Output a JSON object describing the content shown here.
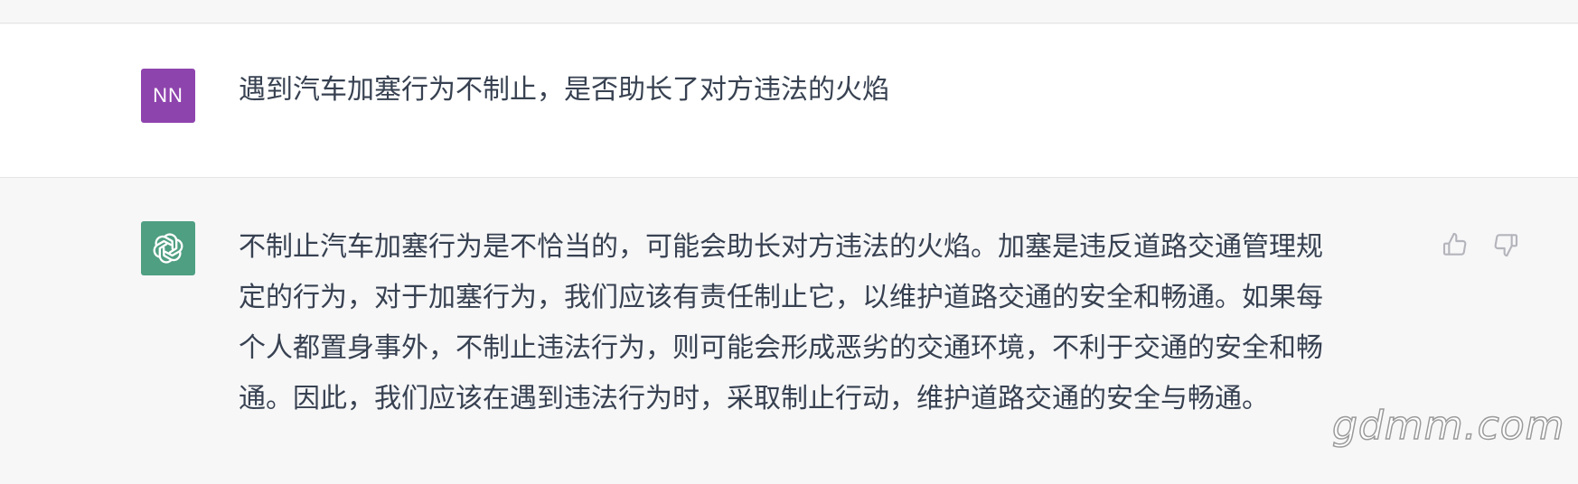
{
  "user_message": {
    "avatar_initials": "NN",
    "text": "遇到汽车加塞行为不制止，是否助长了对方违法的火焰"
  },
  "assistant_message": {
    "avatar_icon": "openai-logo-icon",
    "lines": [
      "不制止汽车加塞行为是不恰当的，可能会助长对方违法的火焰。加塞是违反道路交通管理规",
      "定的行为，对于加塞行为，我们应该有责任制止它，以维护道路交通的安全和畅通。如果每",
      "个人都置身事外，不制止违法行为，则可能会形成恶劣的交通环境，不利于交通的安全和畅",
      "通。因此，我们应该在遇到违法行为时，采取制止行动，维护道路交通的安全与畅通。"
    ]
  },
  "feedback": {
    "thumbs_up_icon": "thumbs-up-icon",
    "thumbs_down_icon": "thumbs-down-icon"
  },
  "watermark": "gdmm.com",
  "colors": {
    "user_avatar_bg": "#8e44ad",
    "bot_avatar_bg": "#4f9f82",
    "user_row_bg": "#ffffff",
    "assistant_row_bg": "#f7f7f8",
    "text": "#374151"
  }
}
